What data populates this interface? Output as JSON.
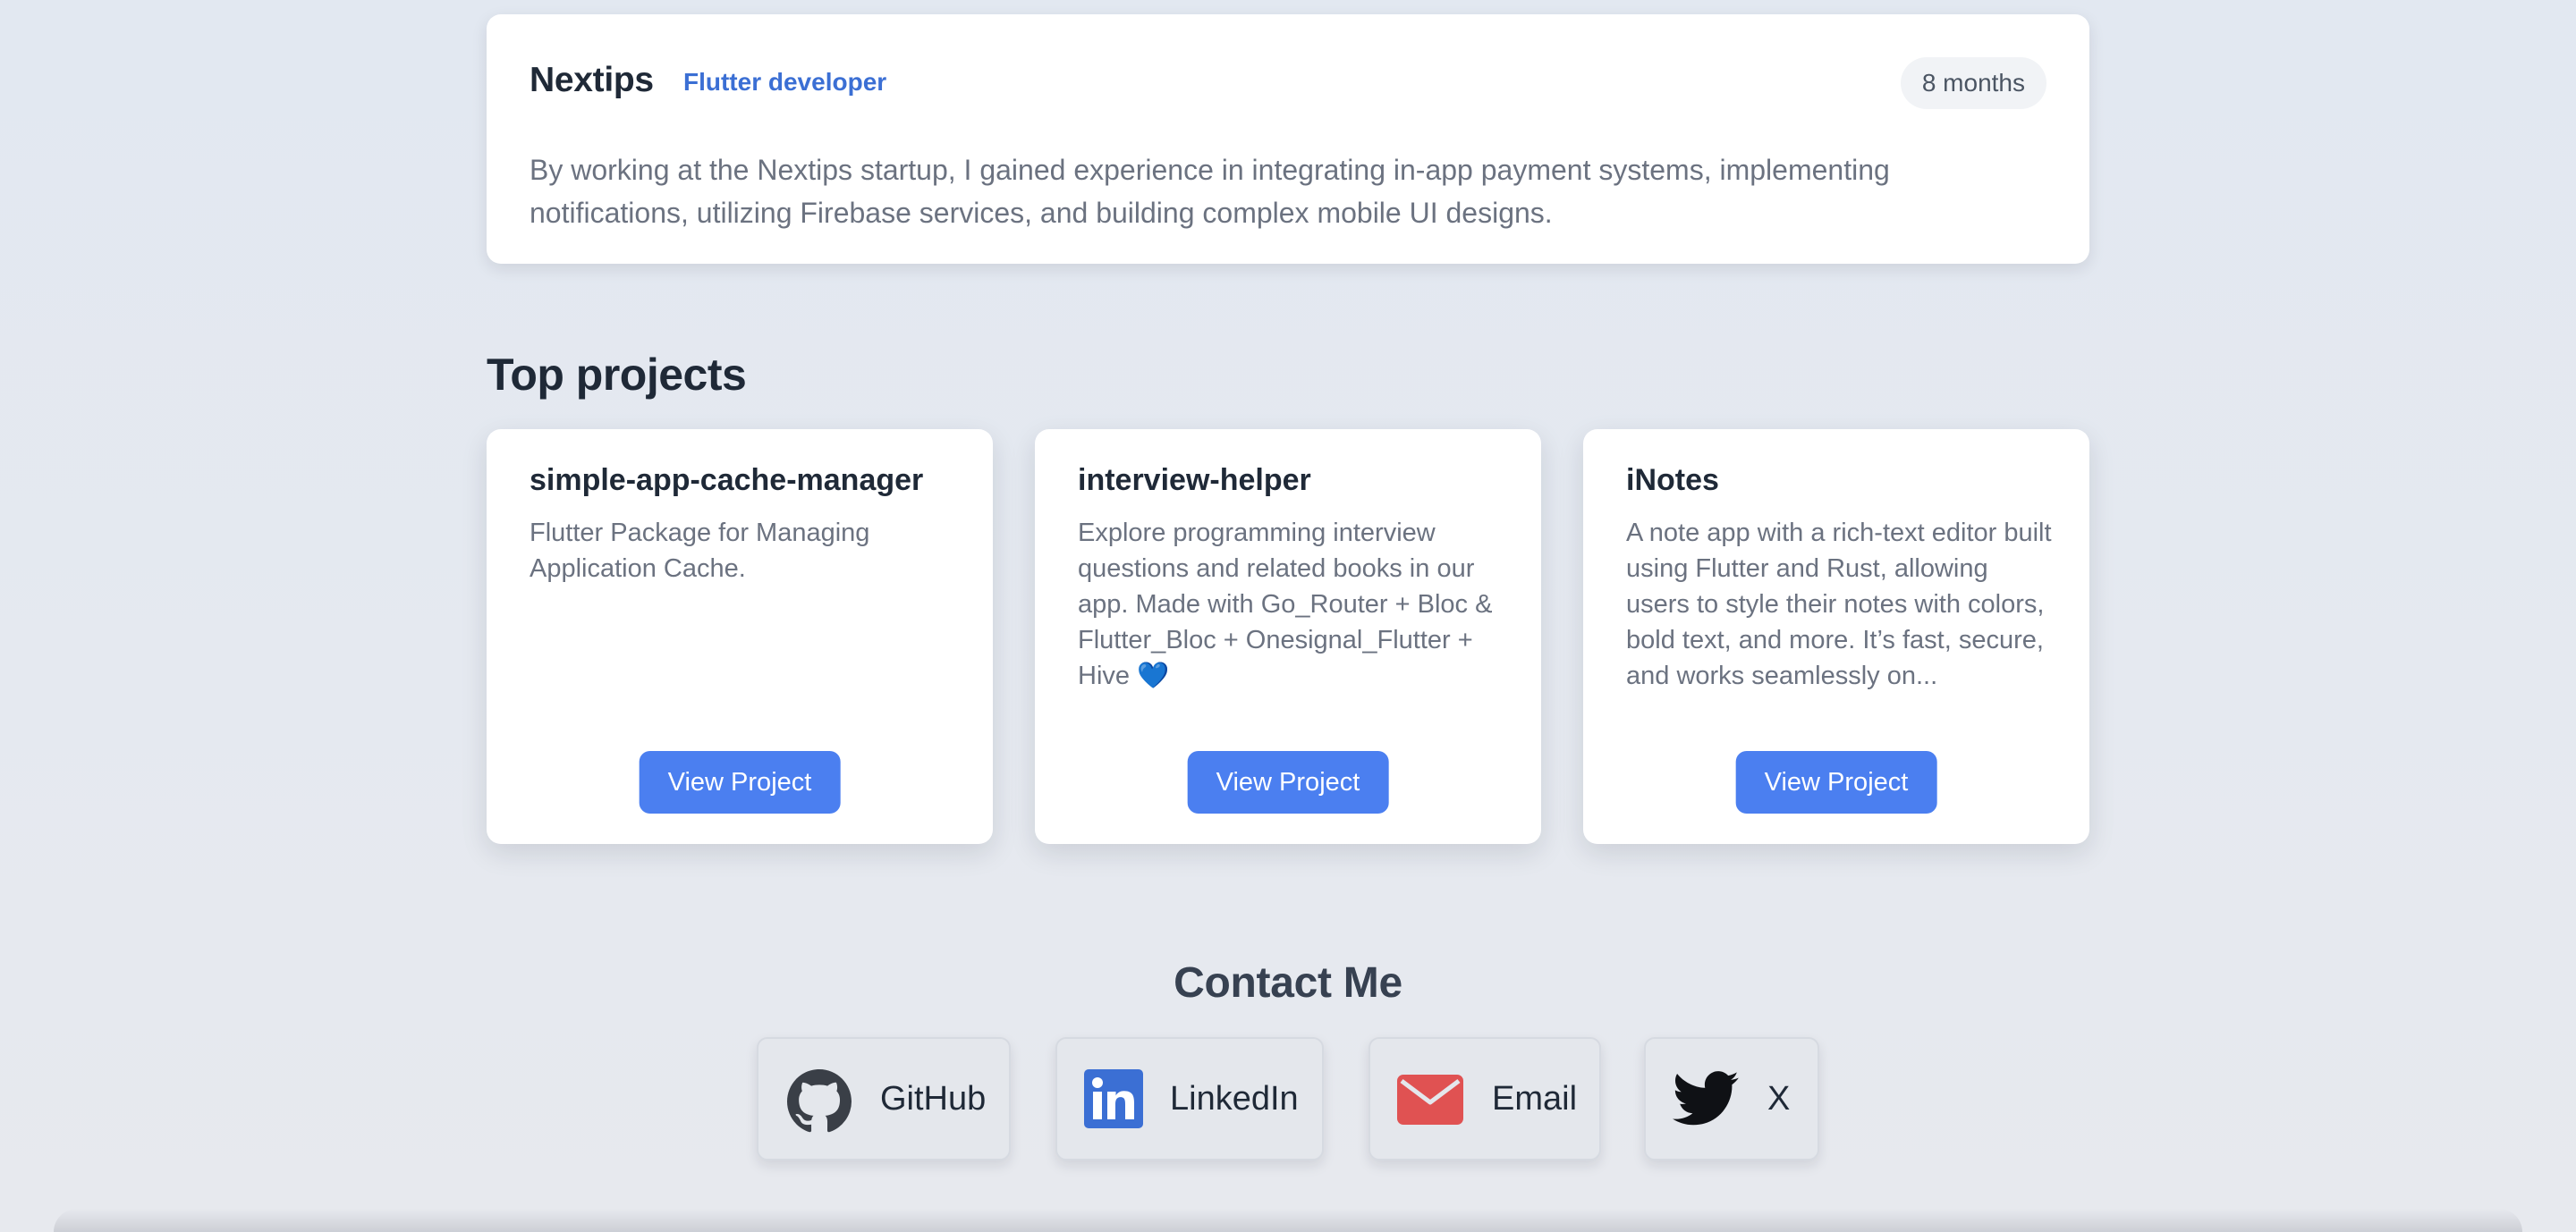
{
  "experience": {
    "company": "Nextips",
    "role": "Flutter developer",
    "duration": "8 months",
    "description": "By working at the Nextips startup, I gained experience in integrating in-app payment systems, implementing notifications, utilizing Firebase services, and building complex mobile UI designs."
  },
  "projects_section": {
    "title": "Top projects",
    "items": [
      {
        "name": "simple-app-cache-manager",
        "description": "Flutter Package for Managing Application Cache.",
        "button_label": "View Project"
      },
      {
        "name": "interview-helper",
        "description": "Explore programming interview questions and related books in our app. Made with Go_Router + Bloc & Flutter_Bloc + Onesignal_Flutter + Hive 💙",
        "button_label": "View Project"
      },
      {
        "name": "iNotes",
        "description": "A note app with a rich-text editor built using Flutter and Rust, allowing users to style their notes with colors, bold text, and more. It’s fast, secure, and works seamlessly on...",
        "button_label": "View Project"
      }
    ]
  },
  "contact": {
    "title": "Contact Me",
    "links": [
      {
        "label": "GitHub",
        "icon": "github-icon"
      },
      {
        "label": "LinkedIn",
        "icon": "linkedin-icon"
      },
      {
        "label": "Email",
        "icon": "email-icon"
      },
      {
        "label": "X",
        "icon": "twitter-icon"
      }
    ]
  },
  "colors": {
    "accent": "#4b7ff0",
    "role_text": "#3b6fd4",
    "linkedin": "#3b6fd4",
    "email": "#e05252",
    "background": "#e3e8f0"
  }
}
